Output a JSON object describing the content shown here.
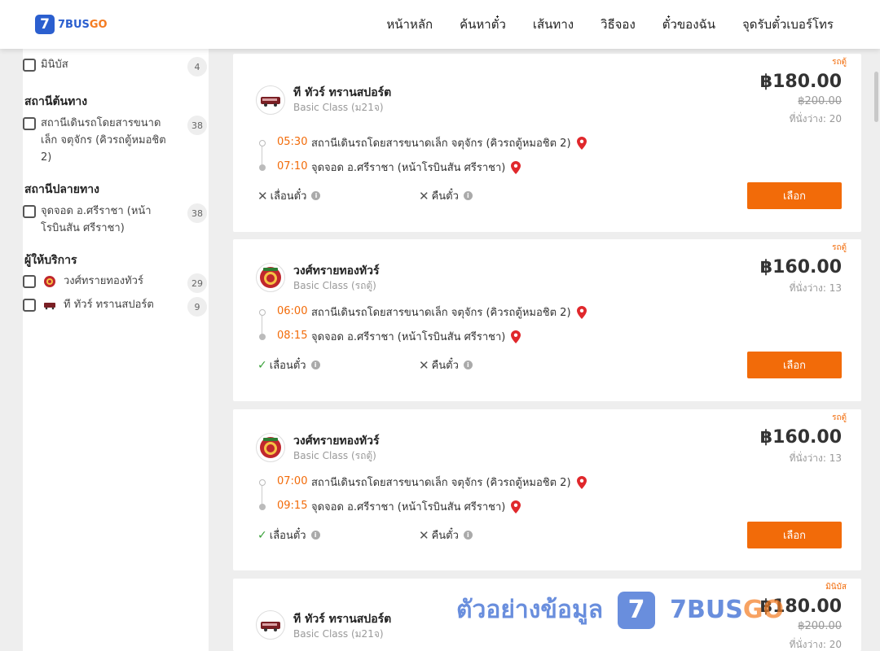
{
  "header": {
    "logo_mark": "7",
    "logo_text_a": "7BUS",
    "logo_text_b": "GO",
    "nav": [
      "หน้าหลัก",
      "ค้นหาตั๋ว",
      "เส้นทาง",
      "วิธีจอง",
      "ตั๋วของฉัน",
      "จุดรับตั๋วเบอร์โทร"
    ]
  },
  "sidebar": {
    "minibus_label": "มินิบัส",
    "minibus_count": "4",
    "origin_title": "สถานีต้นทาง",
    "origin_label": "สถานีเดินรถโดยสารขนาดเล็ก จตุจักร (คิวรถตู้หมอชิต 2)",
    "origin_count": "38",
    "dest_title": "สถานีปลายทาง",
    "dest_label": "จุดจอด อ.ศรีราชา (หน้าโรบินสัน ศรีราชา)",
    "dest_count": "38",
    "provider_title": "ผู้ให้บริการ",
    "providers": [
      {
        "name": "วงศ์ทรายทองทัวร์",
        "count": "29",
        "logo": "lion-logo-icon"
      },
      {
        "name": "ที ทัวร์ ทรานสปอร์ต",
        "count": "9",
        "logo": "bus-logo-icon"
      }
    ]
  },
  "trips": [
    {
      "bus_type": "รถตู้",
      "operator": "ที ทัวร์ ทรานสปอร์ต",
      "class": "Basic Class (ม21จ)",
      "logo": "bus-logo-icon",
      "price": "฿180.00",
      "old_price": "฿200.00",
      "seats": "ที่นั่งว่าง: 20",
      "depart_time": "05:30",
      "depart_stop": "สถานีเดินรถโดยสารขนาดเล็ก จตุจักร (คิวรถตู้หมอชิต 2)",
      "arrive_time": "07:10",
      "arrive_stop": "จุดจอด อ.ศรีราชา (หน้าโรบินสัน ศรีราชา)",
      "postpone_label": "เลื่อนตั๋ว",
      "postpone_allowed": false,
      "refund_label": "คืนตั๋ว",
      "refund_allowed": false,
      "select_label": "เลือก"
    },
    {
      "bus_type": "รถตู้",
      "operator": "วงศ์ทรายทองทัวร์",
      "class": "Basic Class (รถตู้)",
      "logo": "lion-logo-icon",
      "price": "฿160.00",
      "old_price": "",
      "seats": "ที่นั่งว่าง: 13",
      "depart_time": "06:00",
      "depart_stop": "สถานีเดินรถโดยสารขนาดเล็ก จตุจักร (คิวรถตู้หมอชิต 2)",
      "arrive_time": "08:15",
      "arrive_stop": "จุดจอด อ.ศรีราชา (หน้าโรบินสัน ศรีราชา)",
      "postpone_label": "เลื่อนตั๋ว",
      "postpone_allowed": true,
      "refund_label": "คืนตั๋ว",
      "refund_allowed": false,
      "select_label": "เลือก"
    },
    {
      "bus_type": "รถตู้",
      "operator": "วงศ์ทรายทองทัวร์",
      "class": "Basic Class (รถตู้)",
      "logo": "lion-logo-icon",
      "price": "฿160.00",
      "old_price": "",
      "seats": "ที่นั่งว่าง: 13",
      "depart_time": "07:00",
      "depart_stop": "สถานีเดินรถโดยสารขนาดเล็ก จตุจักร (คิวรถตู้หมอชิต 2)",
      "arrive_time": "09:15",
      "arrive_stop": "จุดจอด อ.ศรีราชา (หน้าโรบินสัน ศรีราชา)",
      "postpone_label": "เลื่อนตั๋ว",
      "postpone_allowed": true,
      "refund_label": "คืนตั๋ว",
      "refund_allowed": false,
      "select_label": "เลือก"
    },
    {
      "bus_type": "มินิบัส",
      "operator": "ที ทัวร์ ทรานสปอร์ต",
      "class": "Basic Class (ม21จ)",
      "logo": "bus-logo-icon",
      "price": "฿180.00",
      "old_price": "฿200.00",
      "seats": "ที่นั่งว่าง: 20"
    }
  ],
  "watermark": {
    "text": "ตัวอย่างข้อมูล",
    "mark": "7",
    "brand_a": "7BUS",
    "brand_b": "GO"
  },
  "colors": {
    "accent": "#f26b09",
    "brand_blue": "#2b5fcf",
    "ok_green": "#3aa13a"
  }
}
